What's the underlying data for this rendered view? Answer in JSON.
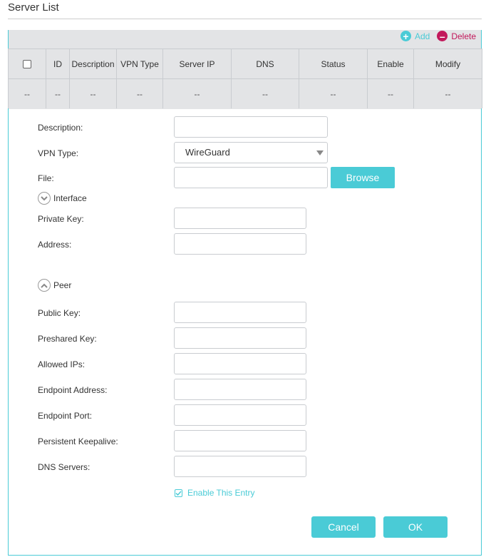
{
  "page": {
    "title": "Server List"
  },
  "toolbar": {
    "add_label": "Add",
    "delete_label": "Delete"
  },
  "table": {
    "columns": [
      "",
      "ID",
      "Description",
      "VPN Type",
      "Server IP",
      "DNS",
      "Status",
      "Enable",
      "Modify"
    ],
    "rows": [
      [
        "--",
        "--",
        "--",
        "--",
        "--",
        "--",
        "--",
        "--",
        "--"
      ]
    ]
  },
  "form": {
    "description_label": "Description:",
    "vpn_type_label": "VPN Type:",
    "vpn_type_value": "WireGuard",
    "file_label": "File:",
    "browse_label": "Browse",
    "interface_label": "Interface",
    "private_key_label": "Private Key:",
    "address_label": "Address:",
    "peer_label": "Peer",
    "public_key_label": "Public Key:",
    "preshared_key_label": "Preshared Key:",
    "allowed_ips_label": "Allowed IPs:",
    "endpoint_address_label": "Endpoint Address:",
    "endpoint_port_label": "Endpoint Port:",
    "persistent_keepalive_label": "Persistent Keepalive:",
    "dns_servers_label": "DNS Servers:",
    "enable_entry_label": "Enable This Entry",
    "enable_entry_checked": true,
    "cancel_label": "Cancel",
    "ok_label": "OK"
  },
  "icons": {
    "add": "plus-circle-icon",
    "delete": "minus-circle-icon",
    "interface_toggle": "chevron-down-circle-icon",
    "peer_toggle": "chevron-up-circle-icon",
    "select_arrow": "caret-down-icon",
    "checkbox": "checkbox-icon"
  },
  "colors": {
    "accent": "#4acbd6",
    "delete": "#c2185b",
    "table_bg": "#e3e4e6"
  }
}
